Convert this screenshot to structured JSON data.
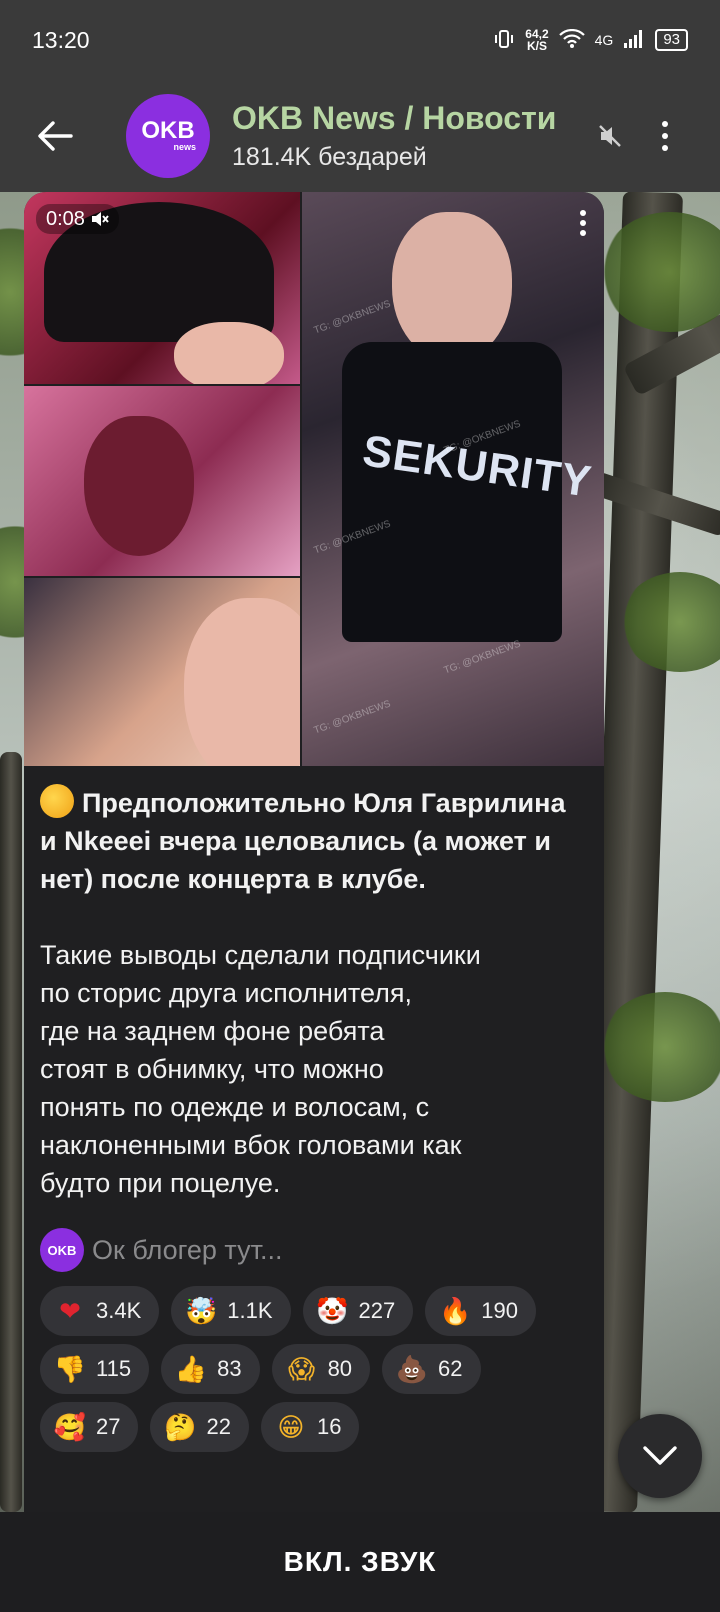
{
  "status": {
    "time": "13:20",
    "speed_value": "64,2",
    "speed_unit": "K/S",
    "network": "4G",
    "battery": "93"
  },
  "header": {
    "avatar_text": "OKB",
    "avatar_sub": "news",
    "title": "OKB News / Новости",
    "subtitle": "181.4K бездарей"
  },
  "video": {
    "time": "0:08",
    "watermark": "TG: @OKBNEWS",
    "shirt_text": "SEKURITY"
  },
  "message": {
    "headline": "Предположительно Юля Гаврилина и Nkeeei вчера целовались (а может и нет) после концерта в клубе.",
    "body": "Такие выводы сделали подписчики\nпо сторис друга исполнителя,\nгде на заднем фоне ребята\nстоят в обнимку, что можно\nпонять по одежде и волосам, с\nнаклоненными вбок головами как\nбудто при поцелуе."
  },
  "reply": {
    "avatar_text": "OKB",
    "text": "Ок блогер тут..."
  },
  "reactions": [
    {
      "icon": "❤",
      "color": "#e0242f",
      "count": "3.4K"
    },
    {
      "icon": "🤯",
      "color": "#f3b32a",
      "count": "1.1K"
    },
    {
      "icon": "🤡",
      "color": "#f2d7c6",
      "count": "227"
    },
    {
      "icon": "🔥",
      "color": "#f06a14",
      "count": "190"
    },
    {
      "icon": "👎",
      "color": "#f5b32e",
      "count": "115"
    },
    {
      "icon": "👍",
      "color": "#f5b32e",
      "count": "83"
    },
    {
      "icon": "😱",
      "color": "#f3b32a",
      "count": "80"
    },
    {
      "icon": "💩",
      "color": "#8a5a2a",
      "count": "62"
    },
    {
      "icon": "🥰",
      "color": "#f3b32a",
      "count": "27"
    },
    {
      "icon": "🤔",
      "color": "#f3b32a",
      "count": "22"
    },
    {
      "icon": "😁",
      "color": "#f3b32a",
      "count": "16"
    }
  ],
  "bottom": {
    "label": "ВКЛ. ЗВУК"
  }
}
